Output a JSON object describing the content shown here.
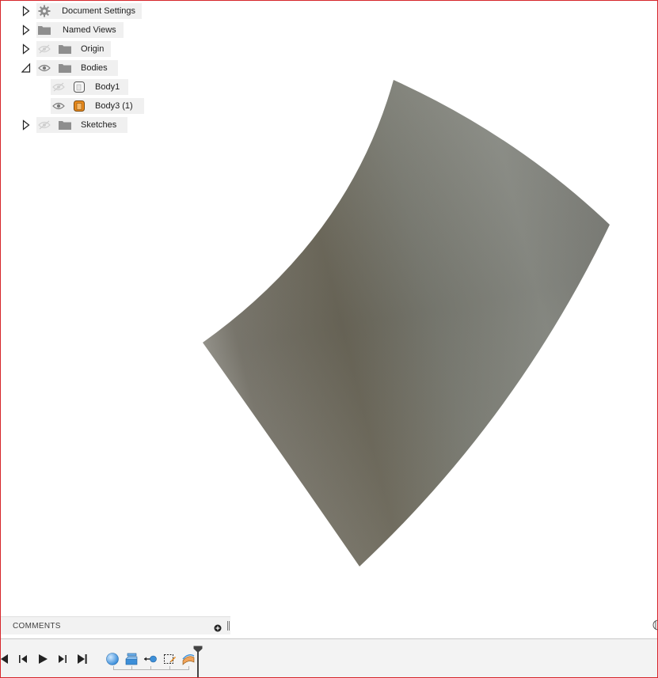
{
  "browser": {
    "items": [
      {
        "label": "Document Settings",
        "icon": "gear-icon",
        "expanded": false,
        "visible": null
      },
      {
        "label": "Named Views",
        "icon": "folder-icon",
        "expanded": false,
        "visible": null
      },
      {
        "label": "Origin",
        "icon": "folder-icon",
        "expanded": false,
        "visible": false
      },
      {
        "label": "Bodies",
        "icon": "folder-icon",
        "expanded": true,
        "visible": true
      },
      {
        "label": "Body1",
        "icon": "body-icon",
        "visible": false
      },
      {
        "label": "Body3 (1)",
        "icon": "body-icon",
        "visible": true
      },
      {
        "label": "Sketches",
        "icon": "folder-icon",
        "expanded": false,
        "visible": false
      }
    ]
  },
  "comments": {
    "title": "COMMENTS"
  },
  "timeline": {
    "controls": [
      "go-to-start",
      "step-back",
      "play",
      "step-forward",
      "go-to-end"
    ],
    "features": [
      "sphere-feature",
      "extrude-feature",
      "move-feature",
      "sketch-feature",
      "split-body-feature"
    ]
  },
  "colors": {
    "frame": "#d6262b",
    "body_orange": "#e8891c",
    "surface": "#7f7f77"
  }
}
